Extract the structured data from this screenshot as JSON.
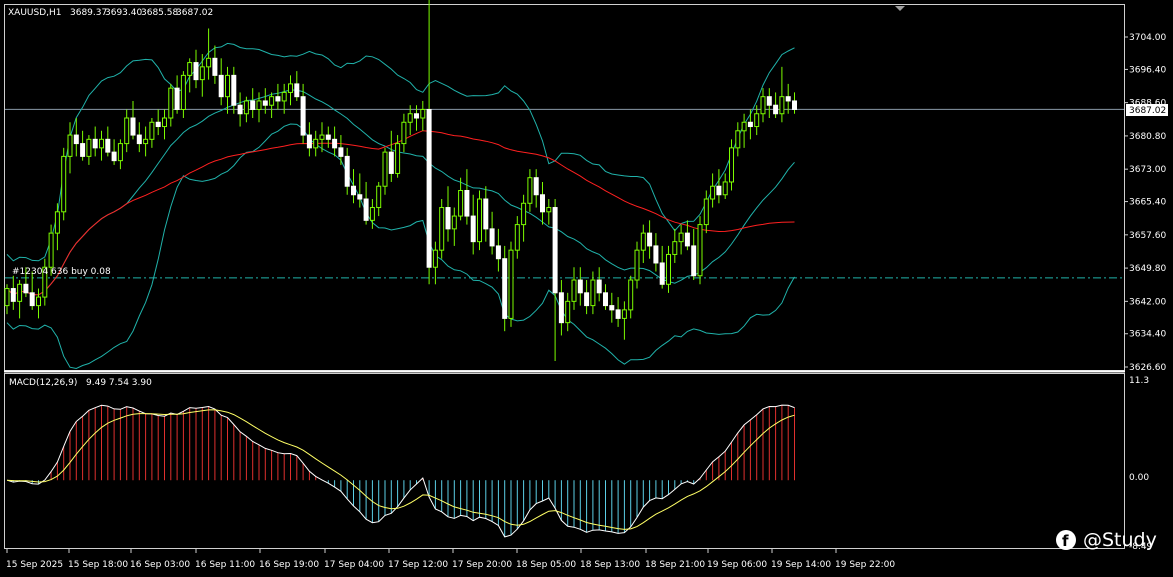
{
  "header": {
    "symbol": "XAUUSD,H1",
    "open": "3689.37",
    "high": "3693.40",
    "low": "3685.58",
    "close": "3687.02"
  },
  "order_label": "#12304 636 buy 0.08",
  "current_price_label": "3687.02",
  "macd": {
    "title": "MACD(12,26,9)",
    "values": "9.49 7.54 3.90",
    "scale": [
      "11.3",
      "0.00",
      "-8.49"
    ]
  },
  "watermark": "@Study",
  "colors": {
    "bull": "#7CFC00",
    "bear": "#FFFFFF",
    "bollinger": "#20B2AA",
    "ma": "#FF2020",
    "hist_pos": "#E0302E",
    "hist_neg": "#5CCFE6",
    "macd_line": "#FFFFFF",
    "signal_line": "#FFFF66",
    "order_line": "#20B2AA"
  },
  "chart_data": {
    "type": "candlestick",
    "symbol": "XAUUSD",
    "timeframe": "H1",
    "price_axis": [
      "3704.00",
      "3696.40",
      "3688.60",
      "3680.80",
      "3673.00",
      "3665.40",
      "3657.60",
      "3649.80",
      "3642.00",
      "3634.40",
      "3626.60"
    ],
    "time_axis": [
      "15 Sep 2025",
      "15 Sep 18:00",
      "16 Sep 03:00",
      "16 Sep 11:00",
      "16 Sep 19:00",
      "17 Sep 04:00",
      "17 Sep 12:00",
      "17 Sep 20:00",
      "18 Sep 05:00",
      "18 Sep 13:00",
      "18 Sep 21:00",
      "19 Sep 06:00",
      "19 Sep 14:00",
      "19 Sep 22:00"
    ],
    "order_price": 3647.5,
    "current_price": 3687.02,
    "candles": [
      {
        "o": 3641,
        "h": 3646,
        "l": 3639,
        "c": 3645
      },
      {
        "o": 3645,
        "h": 3648,
        "l": 3640,
        "c": 3642
      },
      {
        "o": 3642,
        "h": 3647,
        "l": 3638,
        "c": 3646
      },
      {
        "o": 3646,
        "h": 3650,
        "l": 3643,
        "c": 3644
      },
      {
        "o": 3644,
        "h": 3649,
        "l": 3640,
        "c": 3641
      },
      {
        "o": 3641,
        "h": 3645,
        "l": 3638,
        "c": 3643
      },
      {
        "o": 3643,
        "h": 3652,
        "l": 3641,
        "c": 3650
      },
      {
        "o": 3650,
        "h": 3660,
        "l": 3648,
        "c": 3658
      },
      {
        "o": 3658,
        "h": 3665,
        "l": 3654,
        "c": 3663
      },
      {
        "o": 3663,
        "h": 3678,
        "l": 3661,
        "c": 3676
      },
      {
        "o": 3676,
        "h": 3684,
        "l": 3672,
        "c": 3681
      },
      {
        "o": 3681,
        "h": 3685,
        "l": 3676,
        "c": 3679
      },
      {
        "o": 3679,
        "h": 3682,
        "l": 3675,
        "c": 3676
      },
      {
        "o": 3676,
        "h": 3681,
        "l": 3674,
        "c": 3680
      },
      {
        "o": 3680,
        "h": 3683,
        "l": 3676,
        "c": 3678
      },
      {
        "o": 3678,
        "h": 3682,
        "l": 3675,
        "c": 3680
      },
      {
        "o": 3680,
        "h": 3683,
        "l": 3676,
        "c": 3677
      },
      {
        "o": 3677,
        "h": 3680,
        "l": 3674,
        "c": 3675
      },
      {
        "o": 3675,
        "h": 3680,
        "l": 3673,
        "c": 3679
      },
      {
        "o": 3679,
        "h": 3687,
        "l": 3677,
        "c": 3685
      },
      {
        "o": 3685,
        "h": 3689,
        "l": 3680,
        "c": 3681
      },
      {
        "o": 3681,
        "h": 3684,
        "l": 3677,
        "c": 3679
      },
      {
        "o": 3679,
        "h": 3683,
        "l": 3676,
        "c": 3680
      },
      {
        "o": 3680,
        "h": 3685,
        "l": 3678,
        "c": 3684
      },
      {
        "o": 3684,
        "h": 3687,
        "l": 3681,
        "c": 3683
      },
      {
        "o": 3683,
        "h": 3687,
        "l": 3680,
        "c": 3685
      },
      {
        "o": 3685,
        "h": 3693,
        "l": 3683,
        "c": 3692
      },
      {
        "o": 3692,
        "h": 3695,
        "l": 3686,
        "c": 3687
      },
      {
        "o": 3687,
        "h": 3696,
        "l": 3685,
        "c": 3695
      },
      {
        "o": 3695,
        "h": 3699,
        "l": 3691,
        "c": 3698
      },
      {
        "o": 3698,
        "h": 3701,
        "l": 3692,
        "c": 3694
      },
      {
        "o": 3694,
        "h": 3700,
        "l": 3690,
        "c": 3697
      },
      {
        "o": 3697,
        "h": 3706,
        "l": 3694,
        "c": 3699
      },
      {
        "o": 3699,
        "h": 3702,
        "l": 3693,
        "c": 3695
      },
      {
        "o": 3695,
        "h": 3699,
        "l": 3688,
        "c": 3690
      },
      {
        "o": 3690,
        "h": 3697,
        "l": 3686,
        "c": 3695
      },
      {
        "o": 3695,
        "h": 3697,
        "l": 3686,
        "c": 3688
      },
      {
        "o": 3688,
        "h": 3691,
        "l": 3683,
        "c": 3686
      },
      {
        "o": 3686,
        "h": 3690,
        "l": 3684,
        "c": 3689
      },
      {
        "o": 3689,
        "h": 3692,
        "l": 3685,
        "c": 3687
      },
      {
        "o": 3687,
        "h": 3691,
        "l": 3684,
        "c": 3689
      },
      {
        "o": 3689,
        "h": 3692,
        "l": 3686,
        "c": 3688
      },
      {
        "o": 3688,
        "h": 3691,
        "l": 3685,
        "c": 3690
      },
      {
        "o": 3690,
        "h": 3693,
        "l": 3687,
        "c": 3689
      },
      {
        "o": 3689,
        "h": 3693,
        "l": 3686,
        "c": 3691
      },
      {
        "o": 3691,
        "h": 3695,
        "l": 3688,
        "c": 3693
      },
      {
        "o": 3693,
        "h": 3696,
        "l": 3689,
        "c": 3690
      },
      {
        "o": 3690,
        "h": 3693,
        "l": 3679,
        "c": 3681
      },
      {
        "o": 3681,
        "h": 3684,
        "l": 3676,
        "c": 3678
      },
      {
        "o": 3678,
        "h": 3682,
        "l": 3676,
        "c": 3680
      },
      {
        "o": 3680,
        "h": 3684,
        "l": 3677,
        "c": 3681
      },
      {
        "o": 3681,
        "h": 3683,
        "l": 3678,
        "c": 3680
      },
      {
        "o": 3680,
        "h": 3683,
        "l": 3676,
        "c": 3678
      },
      {
        "o": 3678,
        "h": 3681,
        "l": 3674,
        "c": 3676
      },
      {
        "o": 3676,
        "h": 3678,
        "l": 3667,
        "c": 3669
      },
      {
        "o": 3669,
        "h": 3673,
        "l": 3665,
        "c": 3667
      },
      {
        "o": 3667,
        "h": 3672,
        "l": 3664,
        "c": 3666
      },
      {
        "o": 3666,
        "h": 3670,
        "l": 3660,
        "c": 3661
      },
      {
        "o": 3661,
        "h": 3666,
        "l": 3659,
        "c": 3664
      },
      {
        "o": 3664,
        "h": 3670,
        "l": 3662,
        "c": 3669
      },
      {
        "o": 3669,
        "h": 3678,
        "l": 3667,
        "c": 3677
      },
      {
        "o": 3677,
        "h": 3682,
        "l": 3670,
        "c": 3672
      },
      {
        "o": 3672,
        "h": 3681,
        "l": 3671,
        "c": 3679
      },
      {
        "o": 3679,
        "h": 3686,
        "l": 3677,
        "c": 3684
      },
      {
        "o": 3684,
        "h": 3688,
        "l": 3681,
        "c": 3686
      },
      {
        "o": 3686,
        "h": 3688,
        "l": 3682,
        "c": 3685
      },
      {
        "o": 3685,
        "h": 3689,
        "l": 3682,
        "c": 3687
      },
      {
        "o": 3687,
        "h": 3714,
        "l": 3646,
        "c": 3650
      },
      {
        "o": 3650,
        "h": 3656,
        "l": 3646,
        "c": 3654
      },
      {
        "o": 3654,
        "h": 3666,
        "l": 3652,
        "c": 3664
      },
      {
        "o": 3664,
        "h": 3669,
        "l": 3656,
        "c": 3659
      },
      {
        "o": 3659,
        "h": 3664,
        "l": 3655,
        "c": 3662
      },
      {
        "o": 3662,
        "h": 3671,
        "l": 3661,
        "c": 3668
      },
      {
        "o": 3668,
        "h": 3673,
        "l": 3660,
        "c": 3662
      },
      {
        "o": 3662,
        "h": 3667,
        "l": 3653,
        "c": 3656
      },
      {
        "o": 3656,
        "h": 3668,
        "l": 3654,
        "c": 3666
      },
      {
        "o": 3666,
        "h": 3669,
        "l": 3656,
        "c": 3659
      },
      {
        "o": 3659,
        "h": 3663,
        "l": 3653,
        "c": 3655
      },
      {
        "o": 3655,
        "h": 3659,
        "l": 3649,
        "c": 3652
      },
      {
        "o": 3652,
        "h": 3655,
        "l": 3635,
        "c": 3638
      },
      {
        "o": 3638,
        "h": 3656,
        "l": 3636,
        "c": 3654
      },
      {
        "o": 3654,
        "h": 3662,
        "l": 3652,
        "c": 3660
      },
      {
        "o": 3660,
        "h": 3667,
        "l": 3656,
        "c": 3665
      },
      {
        "o": 3665,
        "h": 3673,
        "l": 3663,
        "c": 3671
      },
      {
        "o": 3671,
        "h": 3673,
        "l": 3664,
        "c": 3667
      },
      {
        "o": 3667,
        "h": 3670,
        "l": 3660,
        "c": 3663
      },
      {
        "o": 3663,
        "h": 3666,
        "l": 3660,
        "c": 3664
      },
      {
        "o": 3664,
        "h": 3666,
        "l": 3628,
        "c": 3644
      },
      {
        "o": 3644,
        "h": 3647,
        "l": 3634,
        "c": 3637
      },
      {
        "o": 3637,
        "h": 3644,
        "l": 3635,
        "c": 3642
      },
      {
        "o": 3642,
        "h": 3650,
        "l": 3640,
        "c": 3647
      },
      {
        "o": 3647,
        "h": 3650,
        "l": 3641,
        "c": 3644
      },
      {
        "o": 3644,
        "h": 3647,
        "l": 3639,
        "c": 3641
      },
      {
        "o": 3641,
        "h": 3649,
        "l": 3639,
        "c": 3647
      },
      {
        "o": 3647,
        "h": 3650,
        "l": 3642,
        "c": 3644
      },
      {
        "o": 3644,
        "h": 3646,
        "l": 3640,
        "c": 3641
      },
      {
        "o": 3641,
        "h": 3644,
        "l": 3637,
        "c": 3640
      },
      {
        "o": 3640,
        "h": 3643,
        "l": 3636,
        "c": 3638
      },
      {
        "o": 3638,
        "h": 3642,
        "l": 3633,
        "c": 3640
      },
      {
        "o": 3640,
        "h": 3648,
        "l": 3638,
        "c": 3647
      },
      {
        "o": 3647,
        "h": 3656,
        "l": 3645,
        "c": 3654
      },
      {
        "o": 3654,
        "h": 3660,
        "l": 3651,
        "c": 3658
      },
      {
        "o": 3658,
        "h": 3661,
        "l": 3652,
        "c": 3655
      },
      {
        "o": 3655,
        "h": 3658,
        "l": 3649,
        "c": 3651
      },
      {
        "o": 3651,
        "h": 3655,
        "l": 3645,
        "c": 3646
      },
      {
        "o": 3646,
        "h": 3655,
        "l": 3644,
        "c": 3653
      },
      {
        "o": 3653,
        "h": 3659,
        "l": 3651,
        "c": 3656
      },
      {
        "o": 3656,
        "h": 3660,
        "l": 3653,
        "c": 3658
      },
      {
        "o": 3658,
        "h": 3661,
        "l": 3654,
        "c": 3655
      },
      {
        "o": 3655,
        "h": 3659,
        "l": 3647,
        "c": 3648
      },
      {
        "o": 3648,
        "h": 3662,
        "l": 3646,
        "c": 3660
      },
      {
        "o": 3660,
        "h": 3668,
        "l": 3658,
        "c": 3666
      },
      {
        "o": 3666,
        "h": 3672,
        "l": 3664,
        "c": 3669
      },
      {
        "o": 3669,
        "h": 3673,
        "l": 3665,
        "c": 3667
      },
      {
        "o": 3667,
        "h": 3672,
        "l": 3666,
        "c": 3670
      },
      {
        "o": 3670,
        "h": 3680,
        "l": 3668,
        "c": 3678
      },
      {
        "o": 3678,
        "h": 3684,
        "l": 3676,
        "c": 3682
      },
      {
        "o": 3682,
        "h": 3686,
        "l": 3678,
        "c": 3684
      },
      {
        "o": 3684,
        "h": 3687,
        "l": 3680,
        "c": 3683
      },
      {
        "o": 3683,
        "h": 3688,
        "l": 3681,
        "c": 3686
      },
      {
        "o": 3686,
        "h": 3692,
        "l": 3684,
        "c": 3690
      },
      {
        "o": 3690,
        "h": 3692,
        "l": 3685,
        "c": 3688
      },
      {
        "o": 3688,
        "h": 3691,
        "l": 3685,
        "c": 3686
      },
      {
        "o": 3686,
        "h": 3697,
        "l": 3684,
        "c": 3690
      },
      {
        "o": 3690,
        "h": 3693,
        "l": 3686,
        "c": 3689
      },
      {
        "o": 3689,
        "h": 3691,
        "l": 3686,
        "c": 3687
      }
    ]
  }
}
